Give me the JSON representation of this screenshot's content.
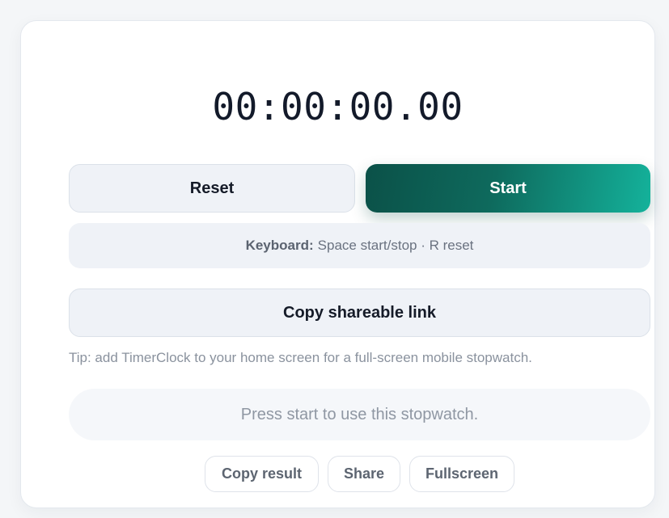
{
  "stopwatch": {
    "display": "00:00:00.00"
  },
  "controls": {
    "reset_label": "Reset",
    "start_label": "Start"
  },
  "keyboard_hint": {
    "label": "Keyboard:",
    "text": "Space start/stop · R reset"
  },
  "share": {
    "copy_link_label": "Copy shareable link"
  },
  "tip": "Tip: add TimerClock to your home screen for a full-screen mobile stopwatch.",
  "status": "Press start to use this stopwatch.",
  "actions": {
    "copy_result_label": "Copy result",
    "share_label": "Share",
    "fullscreen_label": "Fullscreen"
  },
  "colors": {
    "accent_start": "#0b5148",
    "accent_end": "#14b29b",
    "card_background": "#ffffff",
    "page_background": "#f4f6f8"
  }
}
